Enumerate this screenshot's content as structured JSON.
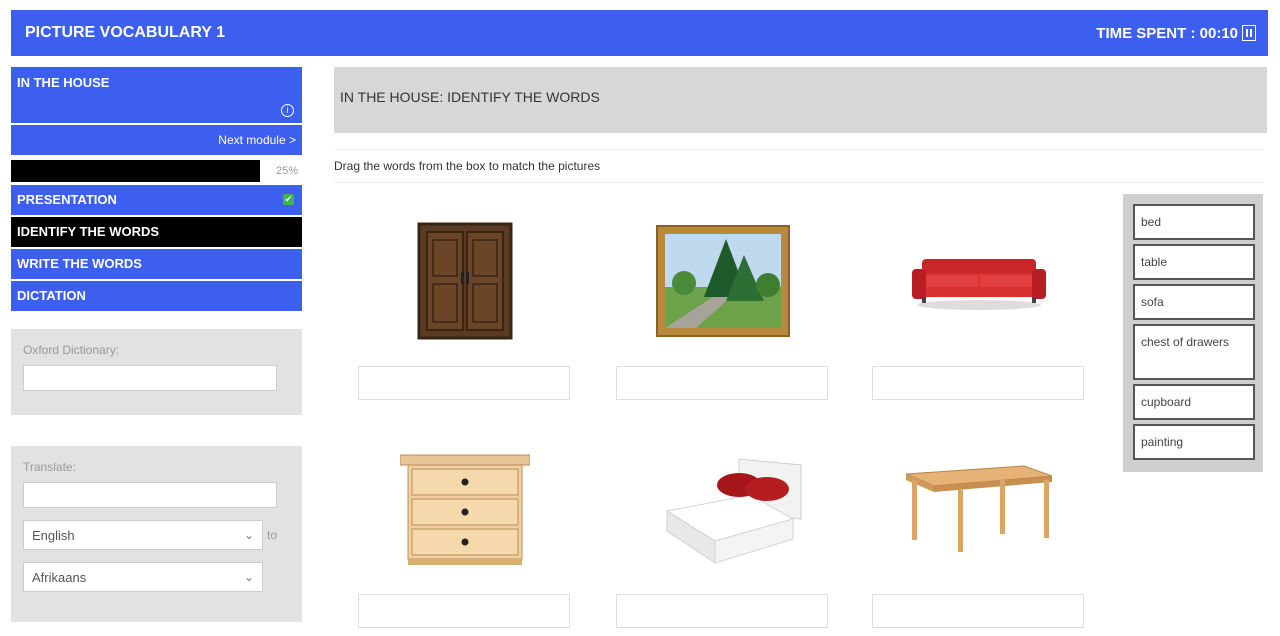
{
  "header": {
    "title": "PICTURE VOCABULARY 1",
    "time_label": "TIME SPENT : 00:10"
  },
  "sidebar": {
    "module_title": "IN THE HOUSE",
    "info_symbol": "i",
    "next_module": "Next module >",
    "progress_percent": "25%",
    "progress_value": 0.25,
    "nav": [
      {
        "label": "PRESENTATION",
        "completed": true
      },
      {
        "label": "IDENTIFY THE WORDS",
        "active": true
      },
      {
        "label": "WRITE THE WORDS"
      },
      {
        "label": "DICTATION"
      }
    ],
    "check_symbol": "✔",
    "dictionary": {
      "label": "Oxford Dictionary:",
      "value": ""
    },
    "translate": {
      "label": "Translate:",
      "value": "",
      "from_language": "English",
      "to_label": "to",
      "to_language": "Afrikaans"
    }
  },
  "main": {
    "title": "IN THE HOUSE: IDENTIFY THE WORDS",
    "instruction": "Drag the words from the box to match the pictures",
    "pictures": [
      "cupboard-image",
      "painting-image",
      "sofa-image",
      "chest-of-drawers-image",
      "bed-image",
      "table-image"
    ]
  },
  "word_bank": [
    "bed",
    "table",
    "sofa",
    "chest of drawers",
    "cupboard",
    "painting"
  ],
  "colors": {
    "primary": "#3d5ff0",
    "active": "#000000",
    "panel": "#e2e2e2",
    "check": "#3fb54a"
  }
}
